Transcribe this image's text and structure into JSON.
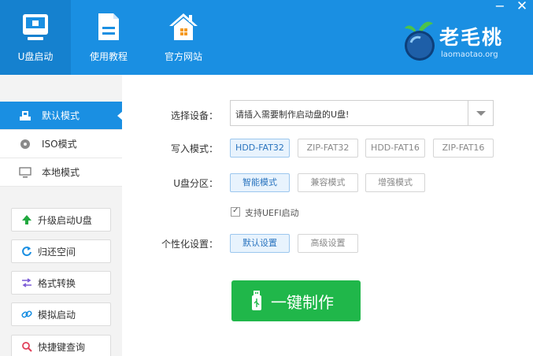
{
  "header": {
    "nav": [
      {
        "label": "U盘启动",
        "icon": "monitor-icon"
      },
      {
        "label": "使用教程",
        "icon": "document-icon"
      },
      {
        "label": "官方网站",
        "icon": "home-icon"
      }
    ],
    "window_controls": {
      "minimize": "−",
      "close": "✕"
    },
    "logo": {
      "title": "老毛桃",
      "subtitle": "laomaotao.org"
    },
    "colors": {
      "header_bg": "#1a8fe2",
      "active_tab": "#1581cf"
    }
  },
  "sidebar": {
    "modes": [
      {
        "label": "默认模式",
        "icon": "usb-drive-icon",
        "active": true
      },
      {
        "label": "ISO模式",
        "icon": "disc-icon",
        "active": false
      },
      {
        "label": "本地模式",
        "icon": "monitor-icon",
        "active": false
      }
    ],
    "tools": [
      {
        "label": "升级启动U盘",
        "icon": "arrow-up-icon"
      },
      {
        "label": "归还空间",
        "icon": "refresh-icon"
      },
      {
        "label": "格式转换",
        "icon": "swap-arrows-icon"
      },
      {
        "label": "模拟启动",
        "icon": "link-icon"
      },
      {
        "label": "快捷键查询",
        "icon": "search-icon"
      }
    ]
  },
  "main": {
    "device": {
      "label": "选择设备：",
      "value": "请插入需要制作启动盘的U盘!"
    },
    "write_mode": {
      "label": "写入模式：",
      "options": [
        "HDD-FAT32",
        "ZIP-FAT32",
        "HDD-FAT16",
        "ZIP-FAT16"
      ],
      "selected": "HDD-FAT32"
    },
    "partition": {
      "label": "U盘分区：",
      "options": [
        "智能模式",
        "兼容模式",
        "增强模式"
      ],
      "selected": "智能模式"
    },
    "uefi": {
      "label": "支持UEFI启动",
      "checked": true
    },
    "personalize": {
      "label": "个性化设置：",
      "options": [
        "默认设置",
        "高级设置"
      ],
      "selected": "默认设置"
    },
    "make_button": {
      "label": "一键制作",
      "color": "#20b74a"
    }
  }
}
